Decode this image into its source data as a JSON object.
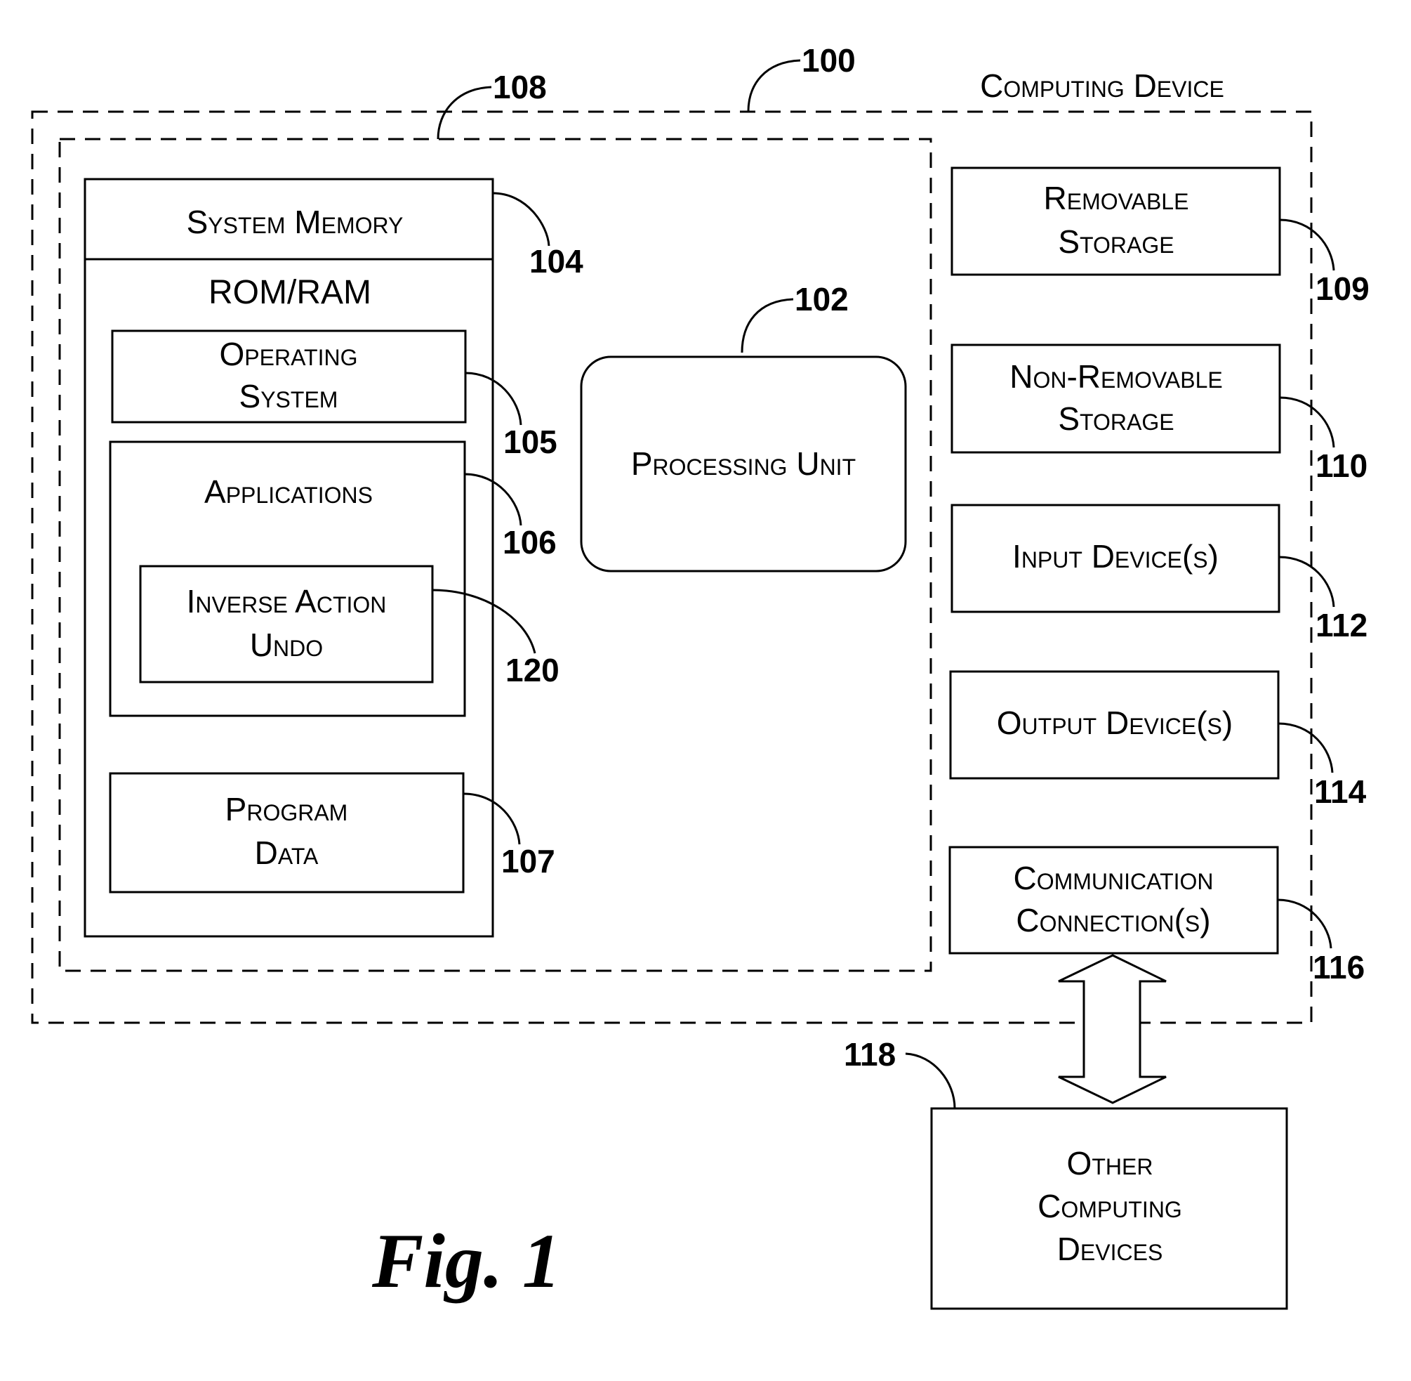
{
  "title": "Computing Device",
  "figure_caption": "Fig. 1",
  "refs": {
    "computing_device": "100",
    "processing_unit": "102",
    "system_memory": "104",
    "operating_system": "105",
    "applications": "106",
    "program_data": "107",
    "core_group": "108",
    "removable_storage": "109",
    "non_removable_storage": "110",
    "input_devices": "112",
    "output_devices": "114",
    "communication_connections": "116",
    "other_computing_devices": "118",
    "inverse_action_undo": "120"
  },
  "labels": {
    "system_memory": "System Memory",
    "rom_ram": "ROM/RAM",
    "operating_system": [
      "Operating",
      "System"
    ],
    "applications": "Applications",
    "inverse_action_undo": [
      "Inverse Action",
      "Undo"
    ],
    "program_data": [
      "Program",
      "Data"
    ],
    "processing_unit": "Processing Unit",
    "removable_storage": [
      "Removable",
      "Storage"
    ],
    "non_removable_storage": [
      "Non-Removable",
      "Storage"
    ],
    "input_devices": "Input Device(s)",
    "output_devices": "Output Device(s)",
    "communication_connections": [
      "Communication",
      "Connection(s)"
    ],
    "other_computing_devices": [
      "Other",
      "Computing",
      "Devices"
    ]
  }
}
